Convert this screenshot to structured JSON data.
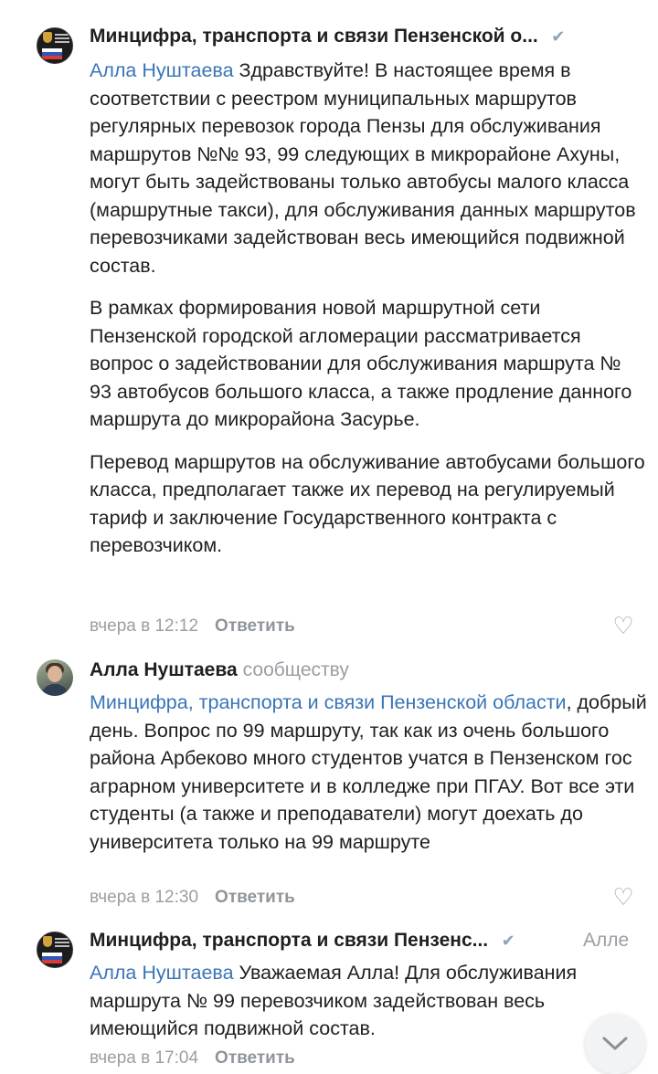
{
  "colors": {
    "link": "#3a74b8",
    "muted": "#9a9ea3",
    "text": "#1f1f1f",
    "verified": "#8aa3c0"
  },
  "comments": [
    {
      "author": "Минцифра, транспорта и связи Пензенской о...",
      "mention": "Алла Нуштаева",
      "first_text": " Здравствуйте! В настоящее время в соответствии с реестром муниципальных маршрутов регулярных перевозок города Пензы для обслуживания маршрутов №№ 93, 99 следующих в микрорайоне Ахуны, могут быть задействованы только автобусы малого класса (маршрутные такси), для обслуживания данных маршрутов перевозчиками задействован весь имеющийся подвижной состав.",
      "paragraph_2": "В рамках формирования новой маршрутной сети Пензенской городской агломерации рассматривается вопрос о задействовании для обслуживания маршрута № 93 автобусов большого класса, а также продление данного маршрута до микрорайона Засурье.",
      "paragraph_3": "Перевод маршрутов на обслуживание автобусами большого класса, предполагает также их перевод на регулируемый тариф и заключение Государственного контракта с перевозчиком.",
      "time": "вчера в 12:12",
      "reply_label": "Ответить",
      "verified_icon": "check-icon",
      "like_icon": "heart-outline-icon"
    },
    {
      "author": "Алла Нуштаева",
      "author_suffix": "сообществу",
      "mention": "Минцифра, транспорта и связи Пензенской области",
      "text": ", добрый день. Вопрос по 99 маршруту, так как из очень большого района Арбеково много студентов учатся в Пензенском гос аграрном университете и в колледже при ПГАУ. Вот все эти студенты (а также и преподаватели) могут доехать до университета только на 99 маршруте",
      "time": "вчера в 12:30",
      "reply_label": "Ответить",
      "like_icon": "heart-outline-icon"
    },
    {
      "author": "Минцифра, транспорта и связи Пензенс...",
      "addressee": "Алле",
      "mention": "Алла Нуштаева",
      "text": " Уважаемая Алла! Для обслуживания маршрута № 99 перевозчиком задействован весь имеющийся подвижной состав.",
      "time": "вчера в 17:04",
      "reply_label": "Ответить",
      "verified_icon": "check-icon"
    }
  ],
  "scroll_down_icon": "chevron-down-icon"
}
